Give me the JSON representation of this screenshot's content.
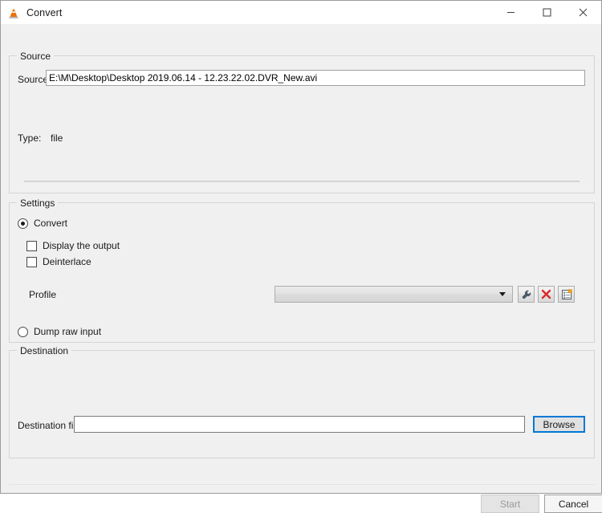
{
  "window": {
    "title": "Convert",
    "app_icon": "vlc-cone-icon",
    "controls": {
      "minimize": "minimize-icon",
      "maximize": "maximize-icon",
      "close": "close-icon"
    }
  },
  "source": {
    "group_title": "Source",
    "source_label": "Source:",
    "source_value": "E:\\M\\Desktop\\Desktop 2019.06.14 - 12.23.22.02.DVR_New.avi",
    "source_placeholder": "",
    "type_label": "Type:",
    "type_value": "file"
  },
  "settings": {
    "group_title": "Settings",
    "convert_radio": {
      "label": "Convert",
      "selected": true
    },
    "display_output_checkbox": {
      "label": "Display the output",
      "checked": false
    },
    "deinterlace_checkbox": {
      "label": "Deinterlace",
      "checked": false
    },
    "profile_label": "Profile",
    "profile_combo": {
      "value": "",
      "arrow_icon": "chevron-down-icon"
    },
    "profile_buttons": [
      {
        "name": "edit-profile",
        "icon": "wrench-icon",
        "tooltip": "Edit selected profile"
      },
      {
        "name": "delete-profile",
        "icon": "close-x-icon",
        "tooltip": "Delete selected profile"
      },
      {
        "name": "new-profile",
        "icon": "new-profile-icon",
        "tooltip": "Create a new profile"
      }
    ],
    "dump_radio": {
      "label": "Dump raw input",
      "selected": false
    }
  },
  "destination": {
    "group_title": "Destination",
    "file_label": "Destination file:",
    "file_value": "",
    "file_placeholder": "",
    "browse_label": "Browse"
  },
  "footer": {
    "start_label": "Start",
    "start_enabled": false,
    "cancel_label": "Cancel",
    "cancel_enabled": true
  },
  "colors": {
    "dialog_background": "#f0f0f0",
    "accent_focus": "#0078d7",
    "delete_icon": "#d92b2b",
    "vlc_orange": "#e8710a",
    "disabled_text": "#9a9a9a"
  }
}
